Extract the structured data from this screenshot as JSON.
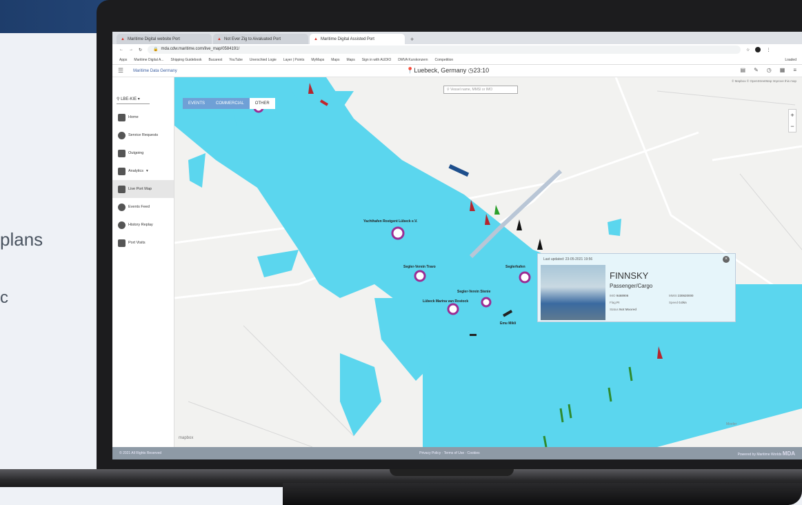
{
  "background": {
    "text_fragments": [
      "plans",
      "c"
    ]
  },
  "browser": {
    "tabs": [
      {
        "label": "Maritime Digital website Port"
      },
      {
        "label": "Not Ever Zig to Aivaluated Port"
      },
      {
        "label": "Maritime Digital Assisted Port"
      }
    ],
    "new_tab": "+",
    "url": "mda.cdw.maritime.com/live_map/0584191/",
    "bookmarks": [
      "Apps",
      "Maritime Digital A...",
      "Shipping Guidebook",
      "Bucarest",
      "YouTube",
      "Unerschied Logie",
      "Layer | Points",
      "MyMaps",
      "Maps",
      "Maps",
      "Sign in with AUDIO",
      "DMVA Kurskonzern",
      "Competition",
      "Loaded"
    ]
  },
  "app": {
    "title": "Maritime Data Germany",
    "location": "Luebeck, Germany",
    "time": "23:10"
  },
  "sidebar": {
    "port_select": "LBE-KIE",
    "items": [
      {
        "label": "Home"
      },
      {
        "label": "Service Requests"
      },
      {
        "label": "Outgoing"
      },
      {
        "label": "Analytics"
      },
      {
        "label": "Live Port Map"
      },
      {
        "label": "Events Feed"
      },
      {
        "label": "History Replay"
      },
      {
        "label": "Port Visits"
      }
    ]
  },
  "map": {
    "filters": [
      "EVENTS",
      "COMMERCIAL",
      "OTHER"
    ],
    "search_placeholder": "Vessel name, MMSI or IMO",
    "attribution": "© Mapbox © OpenStreetMap Improve this map",
    "zoom_in": "+",
    "zoom_out": "−",
    "logo": "mapbox",
    "labels": [
      "Yachthafen Rostgent Lübeck e.V.",
      "Segler-Verein Travo",
      "Seglerhafen",
      "Segler-Verein Stenie",
      "Lübeck Marina van Rostock",
      "Emu Mikli",
      "Moeler"
    ]
  },
  "popup": {
    "timestamp": "Last updated: 23-05-2021 19:56",
    "vessel_name": "FINNSKY",
    "vessel_type": "Passenger/Cargo",
    "fields": [
      {
        "key": "IMO",
        "value": "9468906"
      },
      {
        "key": "MMSI",
        "value": "230620000"
      },
      {
        "key": "Flag",
        "value": "FI"
      },
      {
        "key": "Speed",
        "value": "0.0kn"
      },
      {
        "key": "Status",
        "value": "Not Moored"
      }
    ]
  },
  "footer": {
    "copyright": "© 2021 All Rights Reserved",
    "links": "Privacy Policy · Terms of Use · Cookies",
    "powered": "Powered by Maritime Worlds",
    "brand": "MDA"
  },
  "colors": {
    "water": "#5bd6ee",
    "accent": "#3a5da0",
    "marker": "#9b2d94"
  }
}
